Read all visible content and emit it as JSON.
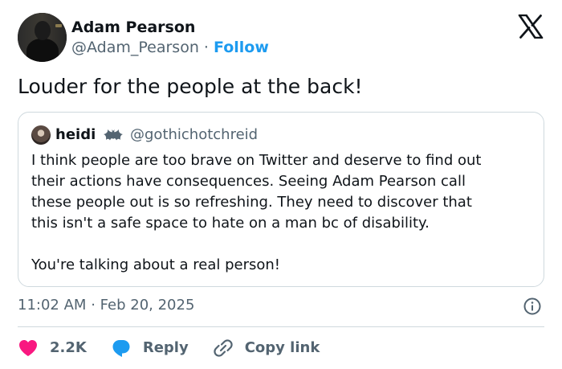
{
  "author": {
    "name": "Adam Pearson",
    "handle": "@Adam_Pearson",
    "separator": "·",
    "follow_label": "Follow"
  },
  "tweet": {
    "text": "Louder for the people at the back!"
  },
  "quote": {
    "name": "heidi",
    "badge_icon": "bat-icon",
    "handle": "@gothichotchreid",
    "lines": [
      "I think people are too brave on Twitter and deserve to find out",
      "their actions have consequences. Seeing Adam Pearson call",
      "these people out is so refreshing. They need to discover that",
      "this isn't a safe space to hate on a man bc of disability."
    ],
    "closing": "You're talking about a real person!"
  },
  "meta": {
    "time": "11:02 AM",
    "separator": "·",
    "date": "Feb 20, 2025"
  },
  "actions": {
    "like_count": "2.2K",
    "reply_label": "Reply",
    "copy_label": "Copy link"
  },
  "colors": {
    "accent": "#1d9bf0",
    "like": "#f91880",
    "text": "#0f1419",
    "muted": "#536471",
    "border": "#cfd9de"
  },
  "icons": {
    "platform": "x-logo-icon",
    "info": "info-icon",
    "like": "heart-icon",
    "reply": "speech-bubble-icon",
    "copy": "link-icon"
  }
}
